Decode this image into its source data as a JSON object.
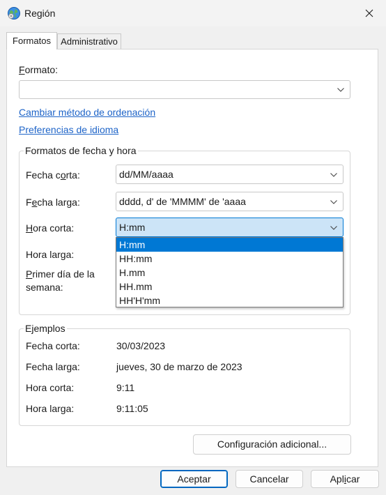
{
  "window": {
    "title": "Región",
    "icon": "globe-region-icon",
    "close_icon": "close-icon"
  },
  "tabs": [
    {
      "label": "Formatos",
      "active": true
    },
    {
      "label": "Administrativo",
      "active": false
    }
  ],
  "format": {
    "label_accel": "F",
    "label_rest": "ormato:",
    "value": ""
  },
  "links": {
    "sort": "Cambiar método de ordenación",
    "language": "Preferencias de idioma"
  },
  "datetime": {
    "title": "Formatos de fecha y hora",
    "short_date": {
      "pre": "Fecha c",
      "accel": "o",
      "post": "rta:",
      "value": "dd/MM/aaaa"
    },
    "long_date": {
      "pre": "F",
      "accel": "e",
      "post": "cha larga:",
      "value": "dddd, d' de 'MMMM' de 'aaaa"
    },
    "short_time": {
      "pre": "",
      "accel": "H",
      "post": "ora corta:",
      "value": "H:mm"
    },
    "long_time": {
      "pre": "Hora lar",
      "accel": "g",
      "post": "a:"
    },
    "first_day": {
      "accel": "P",
      "post": "rimer día de la",
      "line2": "semana:"
    }
  },
  "dropdown_options": [
    "H:mm",
    "HH:mm",
    "H.mm",
    "HH.mm",
    "HH'H'mm"
  ],
  "selected_option": 0,
  "examples": {
    "title": "Ejemplos",
    "rows": [
      {
        "label": "Fecha corta:",
        "value": "30/03/2023"
      },
      {
        "label": "Fecha larga:",
        "value": "jueves, 30 de marzo de 2023"
      },
      {
        "label": "Hora corta:",
        "value": "9:11"
      },
      {
        "label": "Hora larga:",
        "value": "9:11:05"
      }
    ]
  },
  "buttons": {
    "additional": {
      "pre": "Confi",
      "accel": "g",
      "post": "uración adicional..."
    },
    "accept": "Aceptar",
    "cancel": "Cancelar",
    "apply": {
      "pre": "Apl",
      "accel": "i",
      "post": "car"
    }
  },
  "colors": {
    "accent": "#0078d4",
    "link": "#1e64c8",
    "focus_bg": "#cce4f7"
  }
}
